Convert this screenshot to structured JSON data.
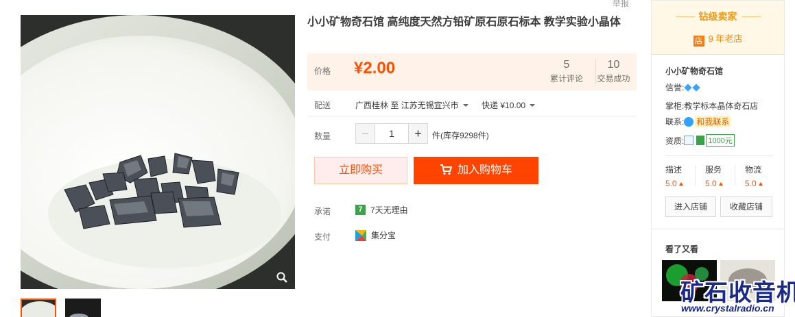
{
  "report_label": "举报",
  "product": {
    "title": "小小矿物奇石馆 高纯度天然方铅矿原石原石标本 教学实验小晶体"
  },
  "price": {
    "label": "价格",
    "value": "¥2.00",
    "reviews_count": "5",
    "reviews_label": "累计评论",
    "deals_count": "10",
    "deals_label": "交易成功"
  },
  "delivery": {
    "label": "配送",
    "route": "广西桂林 至  江苏无锡宜兴市",
    "method": "快递 ¥10.00"
  },
  "quantity": {
    "label": "数量",
    "minus": "−",
    "value": "1",
    "plus": "+",
    "stock_text": "件(库存9298件)"
  },
  "buttons": {
    "buy_now": "立即购买",
    "add_to_cart": "加入购物车"
  },
  "promise": {
    "label": "承诺",
    "badge": "7",
    "text": "7天无理由"
  },
  "payment": {
    "label": "支付",
    "text": "集分宝"
  },
  "shop": {
    "tier": "钻级卖家",
    "years_mark": "店",
    "years": "9 年老店",
    "name": "小小矿物奇石馆",
    "credit_label": "信誉:",
    "keeper_label": "掌柜:",
    "keeper_value": "教学标本晶体奇石店",
    "contact_label": "联系:",
    "contact_link": "和我联系",
    "qual_label": "资质:",
    "deposit": "1000元",
    "scores": [
      {
        "label": "描述",
        "value": "5.0"
      },
      {
        "label": "服务",
        "value": "5.0"
      },
      {
        "label": "物流",
        "value": "5.0"
      }
    ],
    "enter_btn": "进入店铺",
    "fav_btn": "收藏店铺",
    "see_also": "看了又看"
  },
  "watermark": {
    "title": "矿石收音机",
    "url": "www.crystalradio.cn"
  },
  "colors": {
    "accent": "#ff5000",
    "cart_button": "#ff4400",
    "price_panel": "#fff2e8",
    "shop_header": "#fff8e6"
  }
}
